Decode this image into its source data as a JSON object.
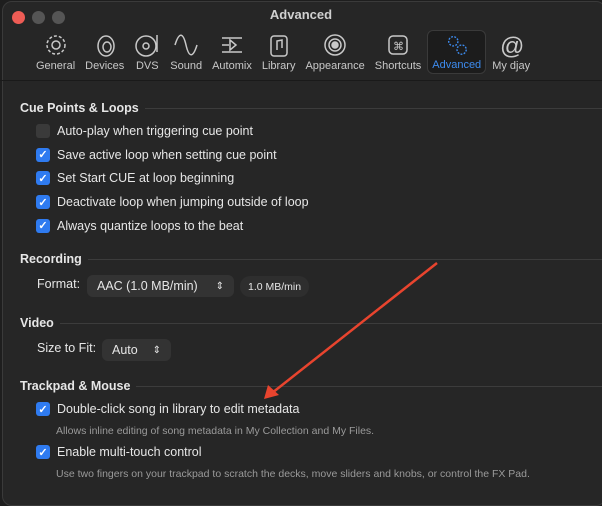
{
  "window": {
    "title": "Advanced"
  },
  "toolbar": [
    {
      "label": "General",
      "icon": "gear-icon"
    },
    {
      "label": "Devices",
      "icon": "speaker-icon"
    },
    {
      "label": "DVS",
      "icon": "turntable-icon"
    },
    {
      "label": "Sound",
      "icon": "waveform-icon"
    },
    {
      "label": "Automix",
      "icon": "automix-icon"
    },
    {
      "label": "Library",
      "icon": "music-library-icon"
    },
    {
      "label": "Appearance",
      "icon": "appearance-icon"
    },
    {
      "label": "Shortcuts",
      "icon": "command-key-icon"
    },
    {
      "label": "Advanced",
      "icon": "gears-icon",
      "active": true
    },
    {
      "label": "My djay",
      "icon": "at-sign-icon"
    }
  ],
  "cue": {
    "title": "Cue Points & Loops",
    "items": [
      {
        "label": "Auto-play when triggering cue point",
        "checked": false
      },
      {
        "label": "Save active loop when setting cue point",
        "checked": true
      },
      {
        "label": "Set Start CUE at loop beginning",
        "checked": true
      },
      {
        "label": "Deactivate loop when jumping outside of loop",
        "checked": true
      },
      {
        "label": "Always quantize loops to the beat",
        "checked": true
      }
    ]
  },
  "recording": {
    "title": "Recording",
    "format_label": "Format:",
    "format_value": "AAC (1.0 MB/min)",
    "rate": "1.0 MB/min"
  },
  "video": {
    "title": "Video",
    "size_label": "Size to Fit:",
    "size_value": "Auto"
  },
  "trackpad": {
    "title": "Trackpad & Mouse",
    "items": [
      {
        "label": "Double-click song in library to edit metadata",
        "desc": "Allows inline editing of song metadata in My Collection and My Files.",
        "checked": true
      },
      {
        "label": "Enable multi-touch control",
        "desc": "Use two fingers on your trackpad to scratch the decks, move sliders and knobs, or control the FX Pad.",
        "checked": true
      }
    ]
  },
  "colors": {
    "accent": "#2f7bf0",
    "annotation": "#e8442e"
  }
}
